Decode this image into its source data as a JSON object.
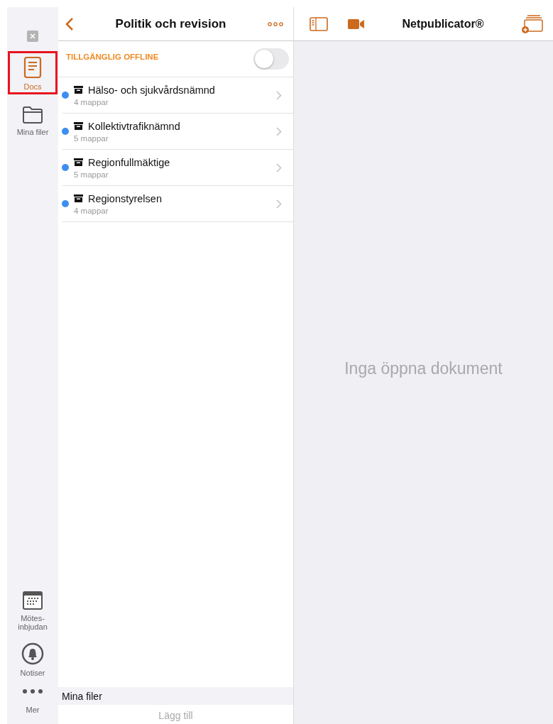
{
  "sidebar": {
    "items": [
      {
        "kind": "docs",
        "label": "Docs",
        "selected": true,
        "highlighted": true
      },
      {
        "kind": "folder",
        "label": "Mina filer",
        "selected": false,
        "highlighted": false
      }
    ],
    "bottom_items": [
      {
        "kind": "calendar",
        "label": "Mötes-\ninbjudan",
        "selected": false
      },
      {
        "kind": "bell",
        "label": "Notiser",
        "selected": false
      },
      {
        "kind": "more",
        "label": "Mer",
        "selected": false
      }
    ]
  },
  "list_panel": {
    "title": "Politik och revision",
    "offline": {
      "label": "TILLGÄNGLIG OFFLINE",
      "on": false
    },
    "folders": [
      {
        "name": "Hälso- och sjukvårdsnämnd",
        "count": "4 mappar",
        "unread": true
      },
      {
        "name": "Kollektivtrafiknämnd",
        "count": "5 mappar",
        "unread": true
      },
      {
        "name": "Regionfullmäktige",
        "count": "5 mappar",
        "unread": true
      },
      {
        "name": "Regionstyrelsen",
        "count": "4 mappar",
        "unread": true
      }
    ],
    "section": {
      "title": "Mina filer",
      "action": "Lägg till"
    }
  },
  "document_pane": {
    "title": "Netpublicator®",
    "empty_message": "Inga öppna dokument"
  }
}
